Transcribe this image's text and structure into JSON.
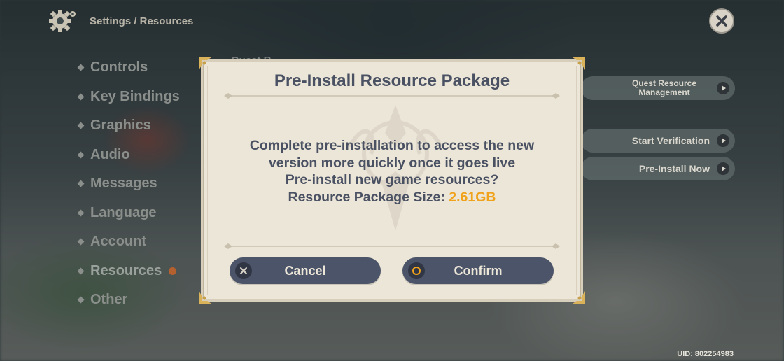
{
  "header": {
    "breadcrumb": "Settings / Resources",
    "settings_icon": "gear-icon",
    "close_icon": "close-icon"
  },
  "sidebar": {
    "items": [
      {
        "label": "Controls"
      },
      {
        "label": "Key Bindings"
      },
      {
        "label": "Graphics"
      },
      {
        "label": "Audio"
      },
      {
        "label": "Messages"
      },
      {
        "label": "Language"
      },
      {
        "label": "Account"
      },
      {
        "label": "Resources",
        "active": true,
        "has_alert": true
      },
      {
        "label": "Other"
      }
    ]
  },
  "background_panel": {
    "section_heading_partial": "Quest R",
    "quest_resource_button": "Quest Resource Management",
    "start_verification_button": "Start Verification",
    "pre_install_now_button": "Pre-Install Now"
  },
  "dialog": {
    "title": "Pre-Install Resource Package",
    "message_line1": "Complete pre-installation to access the new",
    "message_line2": "version more quickly once it goes live",
    "message_line3": "Pre-install new game resources?",
    "size_label": "Resource Package Size: ",
    "size_value": "2.61GB",
    "cancel_label": "Cancel",
    "confirm_label": "Confirm"
  },
  "footer": {
    "uid": "UID: 802254983"
  },
  "colors": {
    "accent_gold": "#f0a21a",
    "dialog_bg": "#ece6d8",
    "button_bg": "#4b5468",
    "text_dark": "#4a5163"
  }
}
